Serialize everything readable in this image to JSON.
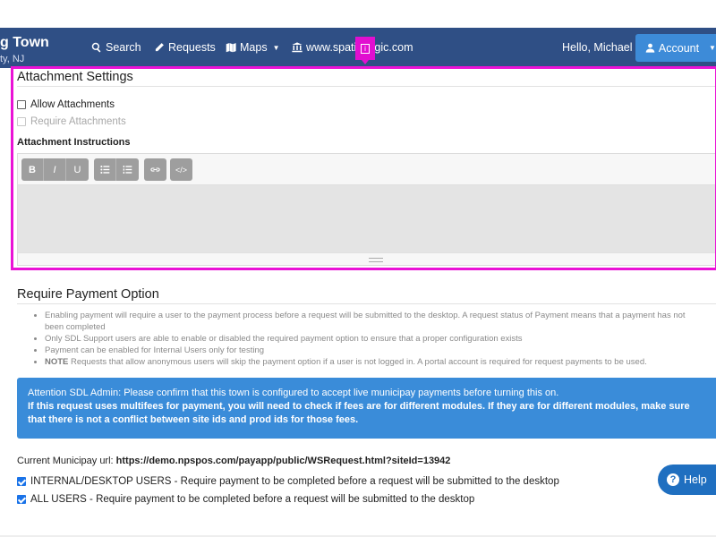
{
  "nav": {
    "brand_title": "g Town",
    "brand_subtitle": "ty, NJ",
    "search_label": "Search",
    "requests_label": "Requests",
    "maps_label": "Maps",
    "website_label": "www.spatia   logic.com",
    "greeting": "Hello, Michael",
    "account_label": "Account",
    "tag_label": "i"
  },
  "attachments": {
    "title": "Attachment Settings",
    "allow_label": "Allow Attachments",
    "require_label": "Require Attachments",
    "instructions_label": "Attachment Instructions",
    "toolbar": {
      "bold": "B",
      "italic": "I",
      "underline": "U",
      "code": "</>"
    }
  },
  "payment": {
    "title": "Require Payment Option",
    "bullets": [
      "Enabling payment will require a user to the payment process before a request will be submitted to the desktop. A request status of Payment means that a payment has not been completed",
      "Only SDL Support users are able to enable or disabled the required payment option to ensure that a proper configuration exists",
      "Payment can be enabled for Internal Users only for testing"
    ],
    "note_label": "NOTE",
    "note_text": " Requests that allow anonymous users will skip the payment option if a user is not logged in. A portal account is required for request payments to be used.",
    "alert_line1": "Attention SDL Admin: Please confirm that this town is configured to accept live municipay payments before turning this on.",
    "alert_line2": "If this request uses multifees for payment, you will need to check if fees are for different modules. If they are for different modules, make sure that there is not a conflict between site ids and prod ids for those fees.",
    "url_label": "Current Municipay url: ",
    "url_value": "https://demo.npspos.com/payapp/public/WSRequest.html?siteId=13942",
    "internal_label": "INTERNAL/DESKTOP USERS - Require payment to be completed before a request will be submitted to the desktop",
    "all_users_label": "ALL USERS - Require payment to be completed before a request will be submitted to the desktop"
  },
  "help": {
    "label": "Help",
    "icon_glyph": "?"
  }
}
